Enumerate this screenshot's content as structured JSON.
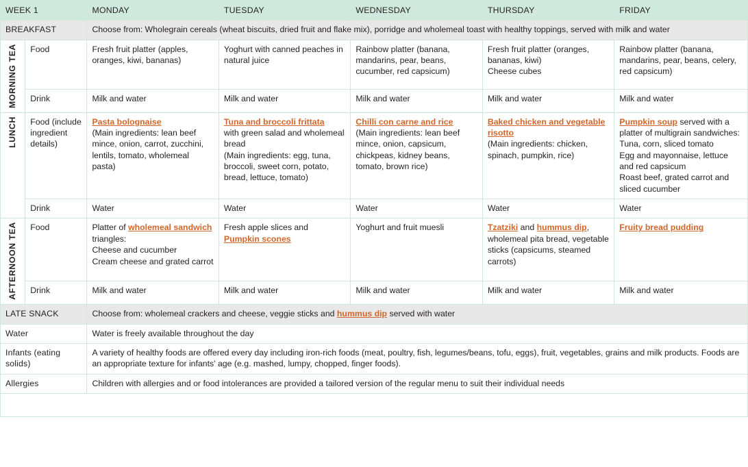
{
  "header": {
    "week_label": "WEEK 1",
    "type_col_label": "",
    "days": [
      "MONDAY",
      "TUESDAY",
      "WEDNESDAY",
      "THURSDAY",
      "FRIDAY"
    ]
  },
  "breakfast": {
    "label": "BREAKFAST",
    "text": "Choose from:  Wholegrain cereals (wheat biscuits, dried fruit and flake mix), porridge and wholemeal toast with healthy toppings, served with milk and water"
  },
  "morning_tea": {
    "category": "MORNING TEA",
    "food_label": "Food",
    "drink_label": "Drink",
    "food": [
      "Fresh fruit platter (apples, oranges, kiwi, bananas)",
      "Yoghurt with canned peaches in natural juice",
      "Rainbow platter (banana, mandarins, pear, beans, cucumber, red capsicum)",
      "Fresh fruit platter (oranges, bananas, kiwi)\nCheese cubes",
      "Rainbow platter (banana, mandarins, pear, beans, celery, red capsicum)"
    ],
    "drink": [
      "Milk and water",
      "Milk and water",
      "Milk and water",
      "Milk and water",
      "Milk and water"
    ]
  },
  "lunch": {
    "category": "LUNCH",
    "food_label": "Food (include ingredient details)",
    "drink_label": "Drink",
    "food": [
      {
        "link_prefix": "",
        "link": "Pasta bolognaise",
        "rest": "\n(Main ingredients: lean beef mince, onion, carrot, zucchini, lentils, tomato, wholemeal pasta)"
      },
      {
        "link_prefix": "",
        "link": "Tuna and broccoli frittata",
        "rest": "\nwith green salad and wholemeal bread\n(Main ingredients: egg, tuna, broccoli, sweet corn, potato, bread, lettuce, tomato)"
      },
      {
        "link_prefix": "",
        "link": "Chilli con carne and rice",
        "rest": "\n(Main ingredients: lean beef mince, onion, capsicum, chickpeas, kidney beans, tomato, brown rice)"
      },
      {
        "link_prefix": "",
        "link": "Baked chicken and vegetable risotto",
        "rest": "\n(Main ingredients: chicken, spinach, pumpkin, rice)"
      },
      {
        "link_prefix": "",
        "link": "Pumpkin soup",
        "rest": " served with a platter of multigrain sandwiches:\nTuna, corn, sliced tomato\nEgg and mayonnaise, lettuce and red capsicum\nRoast beef, grated carrot and sliced cucumber"
      }
    ],
    "drink": [
      "Water",
      "Water",
      "Water",
      "Water",
      "Water"
    ]
  },
  "afternoon_tea": {
    "category": "AFTERNOON TEA",
    "food_label": "Food",
    "drink_label": "Drink",
    "food": [
      {
        "pre": "Platter of ",
        "link": "wholemeal sandwich",
        "post": " triangles:\nCheese and cucumber\nCream cheese and grated carrot"
      },
      {
        "pre": "Fresh apple slices and\n",
        "link": "Pumpkin scones",
        "post": ""
      },
      {
        "pre": "Yoghurt and fruit muesli",
        "link": "",
        "post": ""
      },
      {
        "pre": "",
        "link": "Tzatziki",
        "mid": " and ",
        "link2": "hummus dip",
        "post": ",\nwholemeal pita bread, vegetable sticks (capsicums, steamed carrots)"
      },
      {
        "pre": "",
        "link": "Fruity bread pudding",
        "post": ""
      }
    ],
    "drink": [
      "Milk and water",
      "Milk and water",
      "Milk and water",
      "Milk and water",
      "Milk and water"
    ]
  },
  "late_snack": {
    "label": "LATE SNACK",
    "pre": "Choose from: wholemeal crackers and cheese, veggie sticks and ",
    "link": "hummus dip",
    "post": " served with water"
  },
  "water": {
    "label": "Water",
    "text": "Water is freely available throughout the day"
  },
  "infants": {
    "label": "Infants (eating solids)",
    "text": "A variety of healthy foods are offered every day including iron-rich foods (meat, poultry, fish, legumes/beans, tofu, eggs), fruit, vegetables, grains and milk products. Foods are an appropriate texture for infants' age (e.g. mashed, lumpy, chopped, finger foods)."
  },
  "allergies": {
    "label": "Allergies",
    "text": "Children with allergies and or food intolerances are provided a tailored version of the regular menu to suit their individual needs"
  },
  "colors": {
    "header_bg": "#cfe9de",
    "band_bg": "#e8e8e8",
    "border": "#cfe8dd",
    "link": "#d2662a",
    "week_text": "#1f3864"
  }
}
